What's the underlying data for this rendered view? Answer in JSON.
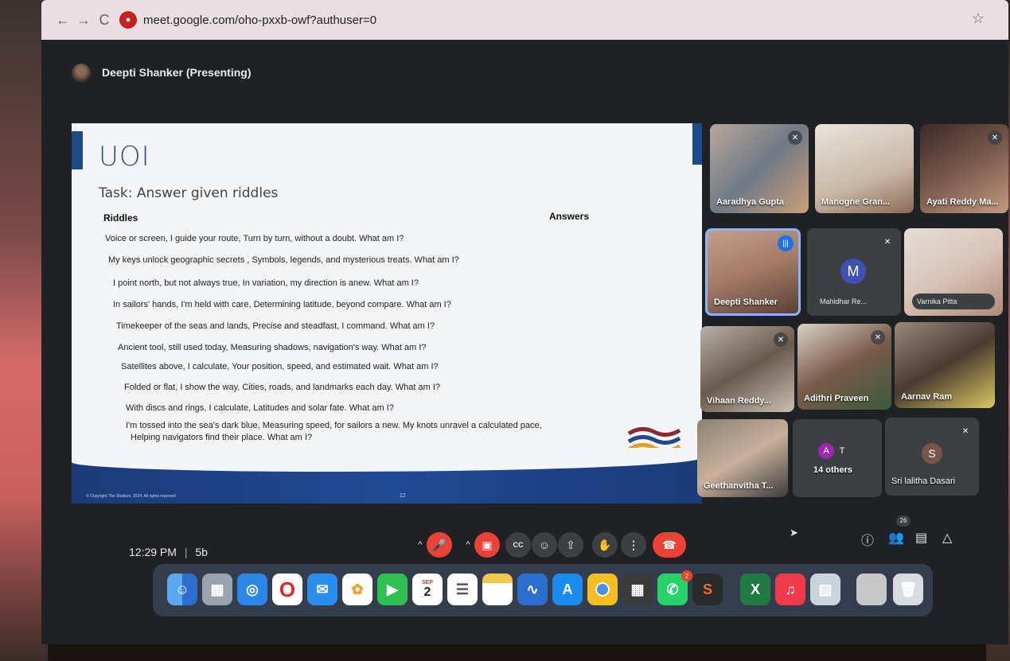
{
  "browser": {
    "url": "meet.google.com/oho-pxxb-owf?authuser=0",
    "back": "←",
    "forward": "→",
    "reload": "C",
    "star": "☆"
  },
  "meet": {
    "presenter_label": "Deepti Shanker (Presenting)"
  },
  "slide": {
    "title": "UOI",
    "subtitle": "Task: Answer given riddles",
    "riddles_header": "Riddles",
    "answers_header": "Answers",
    "riddles": [
      "Voice or screen, I guide your route, Turn by turn, without a doubt. What am I?",
      "My keys unlock geographic secrets , Symbols, legends, and mysterious treats. What am I?",
      "I point north, but not always true, In variation, my direction is anew. What am I?",
      "In sailors' hands, I'm held with care, Determining latitude, beyond compare. What am I?",
      "Timekeeper of the seas and lands, Precise and steadfast, I command. What am I?",
      "Ancient tool, still used today, Measuring shadows, navigation's way. What am I?",
      "Satellites above, I calculate,  Your position, speed, and estimated wait. What am I?",
      "Folded or flat, I show the way, Cities, roads, and landmarks each day. What am I?",
      "With discs and rings, I calculate, Latitudes and solar fate. What am I?",
      "I'm tossed into the sea's dark blue, Measuring speed, for sailors a new. My knots unravel a calculated pace,",
      "Helping navigators find their place. What am I?"
    ],
    "copyright": "© Copyright The Stadium, 2024. All rights reserved",
    "page_number": "12"
  },
  "participants": [
    {
      "name": "Aaradhya Gupta",
      "muted": true
    },
    {
      "name": "Manogne Gran...",
      "muted": false
    },
    {
      "name": "Ayati Reddy Ma...",
      "muted": true
    },
    {
      "name": "Deepti Shanker",
      "speaking": true
    },
    {
      "name": "Mahidhar Re...",
      "initial": "M",
      "muted": true
    },
    {
      "name": "Varnika Pitta",
      "muted": false
    },
    {
      "name": "Vihaan Reddy...",
      "muted": true
    },
    {
      "name": "Adithri Praveen",
      "muted": true
    },
    {
      "name": "Aarnav Ram",
      "muted": false
    },
    {
      "name": "Geethanvitha T...",
      "muted": false
    },
    {
      "name": "14 others",
      "initials": [
        "A",
        "T"
      ]
    },
    {
      "name": "Sri lalitha Dasari",
      "initial": "S",
      "muted": true
    }
  ],
  "controls": {
    "time": "12:29 PM",
    "separator": "|",
    "meeting_code": "5b",
    "people_count": "26",
    "caption_label": "CC"
  },
  "dock": {
    "calendar_month": "SEP",
    "calendar_day": "2",
    "whatsapp_badge": "2"
  },
  "colors": {
    "meet_red": "#ea4335",
    "meet_blue": "#1a73e8",
    "slide_blue": "#1e4a8c"
  }
}
